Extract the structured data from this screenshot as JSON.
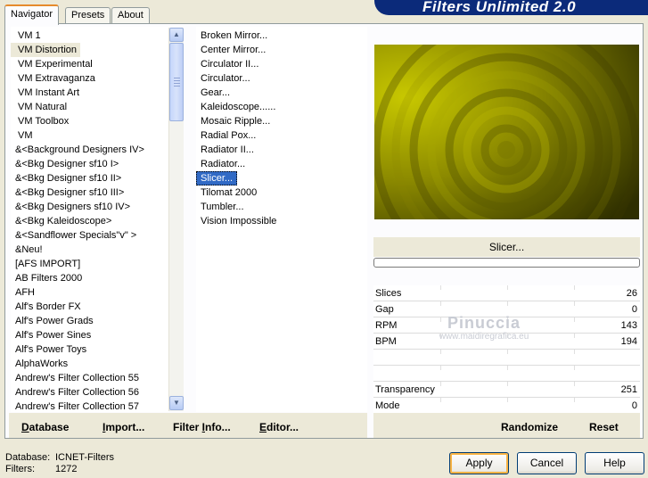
{
  "tabs": [
    "Navigator",
    "Presets",
    "About"
  ],
  "banner": {
    "title": "Filters Unlimited 2.0"
  },
  "categories": [
    "VM 1",
    "VM Distortion",
    "VM Experimental",
    "VM Extravaganza",
    "VM Instant Art",
    "VM Natural",
    "VM Toolbox",
    "VM",
    "&<Background Designers IV>",
    "&<Bkg Designer sf10 I>",
    "&<Bkg Designer sf10 II>",
    "&<Bkg Designer sf10 III>",
    "&<Bkg Designers sf10 IV>",
    "&<Bkg Kaleidoscope>",
    "&<Sandflower Specials\"v\" >",
    "&Neu!",
    "[AFS IMPORT]",
    "AB Filters 2000",
    "AFH",
    "Alf's Border FX",
    "Alf's Power Grads",
    "Alf's Power Sines",
    "Alf's Power Toys",
    "AlphaWorks",
    "Andrew's Filter Collection 55",
    "Andrew's Filter Collection 56",
    "Andrew's Filter Collection 57"
  ],
  "selected_category_index": 1,
  "filters": [
    "Broken Mirror...",
    "Center Mirror...",
    "Circulator II...",
    "Circulator...",
    "Gear...",
    "Kaleidoscope......",
    "Mosaic Ripple...",
    "Radial Pox...",
    "Radiator II...",
    "Radiator...",
    "Slicer...",
    "Tilomat 2000",
    "Tumbler...",
    "Vision Impossible"
  ],
  "selected_filter_index": 10,
  "left_buttons": {
    "database": {
      "hot": "D",
      "rest": "atabase"
    },
    "import": {
      "hot": "I",
      "rest": "mport..."
    },
    "filterinfo": {
      "pre": "Filter ",
      "hot": "I",
      "rest": "nfo..."
    },
    "editor": {
      "hot": "E",
      "rest": "ditor..."
    }
  },
  "filter_name": "Slicer...",
  "progress": 0,
  "params": [
    {
      "label": "Slices",
      "value": "26"
    },
    {
      "label": "Gap",
      "value": "0"
    },
    {
      "label": "RPM",
      "value": "143"
    },
    {
      "label": "BPM",
      "value": "194"
    },
    {
      "label": "",
      "value": ""
    },
    {
      "label": "",
      "value": ""
    },
    {
      "label": "Transparency",
      "value": "251"
    },
    {
      "label": "Mode",
      "value": "0"
    }
  ],
  "watermark": {
    "name": "Pinuccia",
    "url": "www.maidiregrafica.eu"
  },
  "right_buttons": {
    "randomize": "Randomize",
    "reset": "Reset"
  },
  "status": {
    "database_label": "Database:",
    "database_value": "ICNET-Filters",
    "filters_label": "Filters:",
    "filters_value": "1272"
  },
  "dialog_buttons": {
    "apply": "Apply",
    "cancel": "Cancel",
    "help": "Help"
  },
  "colors": {
    "selection": "#316ac5",
    "banner": "#0b2a7a",
    "preview_center": "#c8c800",
    "preview_edge": "#3a3a00"
  }
}
